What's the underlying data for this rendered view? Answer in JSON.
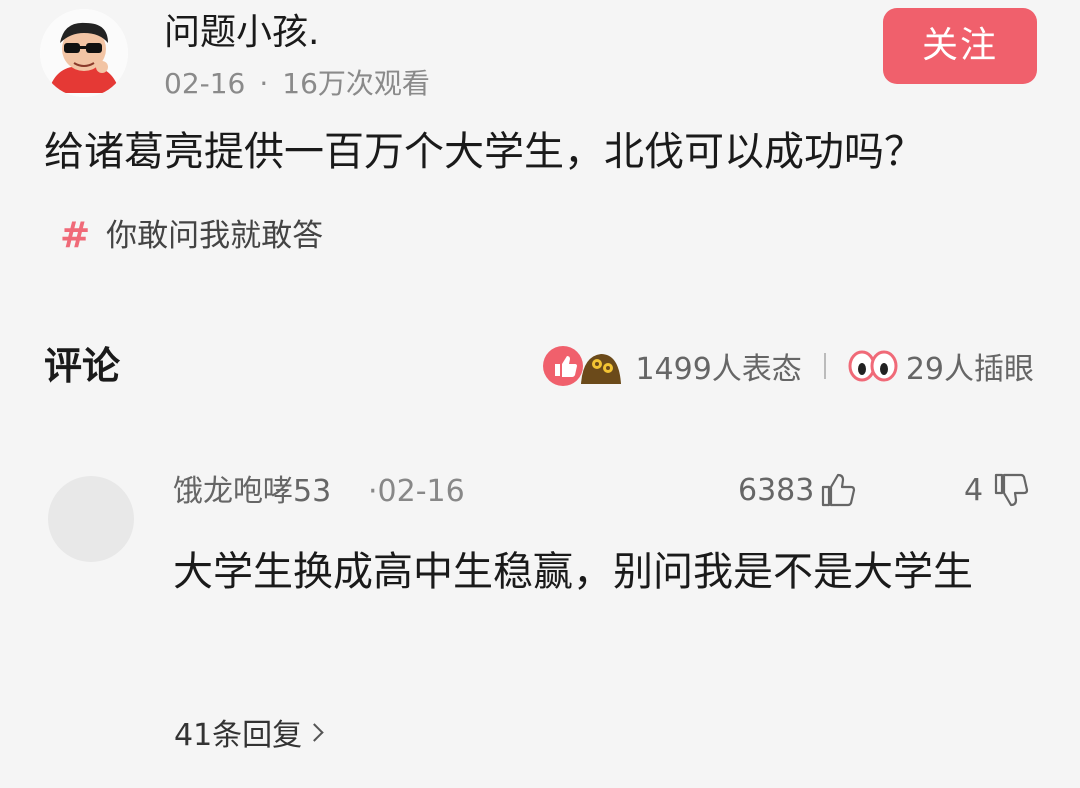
{
  "post": {
    "author": "问题小孩.",
    "date": "02-16",
    "meta_sep": "·",
    "views": "16万次观看",
    "follow_label": "关注",
    "question": "给诸葛亮提供一百万个大学生，北伐可以成功吗？",
    "topic_hash": "#",
    "topic": "你敢问我就敢答"
  },
  "comments_section": {
    "heading": "评论",
    "reactions_count": "1499人表态",
    "eye_count": "29人插眼"
  },
  "comment": {
    "author": "饿龙咆哮53",
    "date": "·02-16",
    "likes": "6383",
    "dislikes": "4",
    "text": "大学生换成高中生稳赢，别问我是不是大学生",
    "replies": "41条回复"
  },
  "colors": {
    "accent": "#f0606c",
    "topic_hash": "#f06a78",
    "background": "#f5f5f5"
  }
}
